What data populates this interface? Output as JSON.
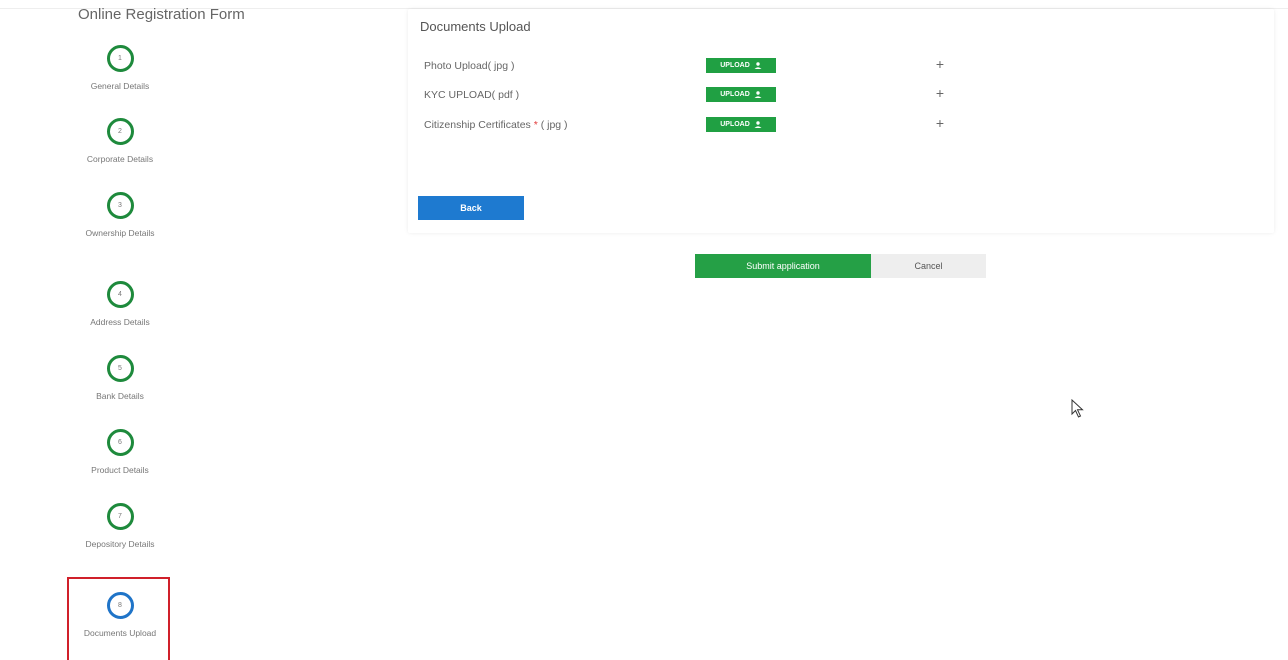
{
  "form": {
    "title": "Online Registration Form"
  },
  "steps": [
    {
      "number": "1",
      "label": "General Details"
    },
    {
      "number": "2",
      "label": "Corporate Details"
    },
    {
      "number": "3",
      "label": "Ownership Details"
    },
    {
      "number": "4",
      "label": "Address Details"
    },
    {
      "number": "5",
      "label": "Bank Details"
    },
    {
      "number": "6",
      "label": "Product Details"
    },
    {
      "number": "7",
      "label": "Depository Details"
    },
    {
      "number": "8",
      "label": "Documents Upload",
      "active": true
    }
  ],
  "documents": {
    "title": "Documents Upload",
    "rows": [
      {
        "label": "Photo Upload( jpg )",
        "required_mark": "",
        "suffix": "",
        "button": "UPLOAD"
      },
      {
        "label": "KYC UPLOAD( pdf )",
        "required_mark": "",
        "suffix": "",
        "button": "UPLOAD"
      },
      {
        "label": "Citizenship Certificates",
        "required_mark": " * ",
        "suffix": "( jpg )",
        "button": "UPLOAD"
      }
    ],
    "back_label": "Back"
  },
  "actions": {
    "submit_label": "Submit application",
    "cancel_label": "Cancel"
  },
  "colors": {
    "step_complete": "#1e8a3c",
    "step_active": "#1f74c8",
    "upload": "#20a043",
    "back": "#1e7ad0",
    "submit": "#25a046",
    "highlight": "#d0202a"
  },
  "icons": {
    "upload": "upload-person-icon",
    "add": "plus-icon",
    "cursor": "mouse-cursor-icon"
  }
}
